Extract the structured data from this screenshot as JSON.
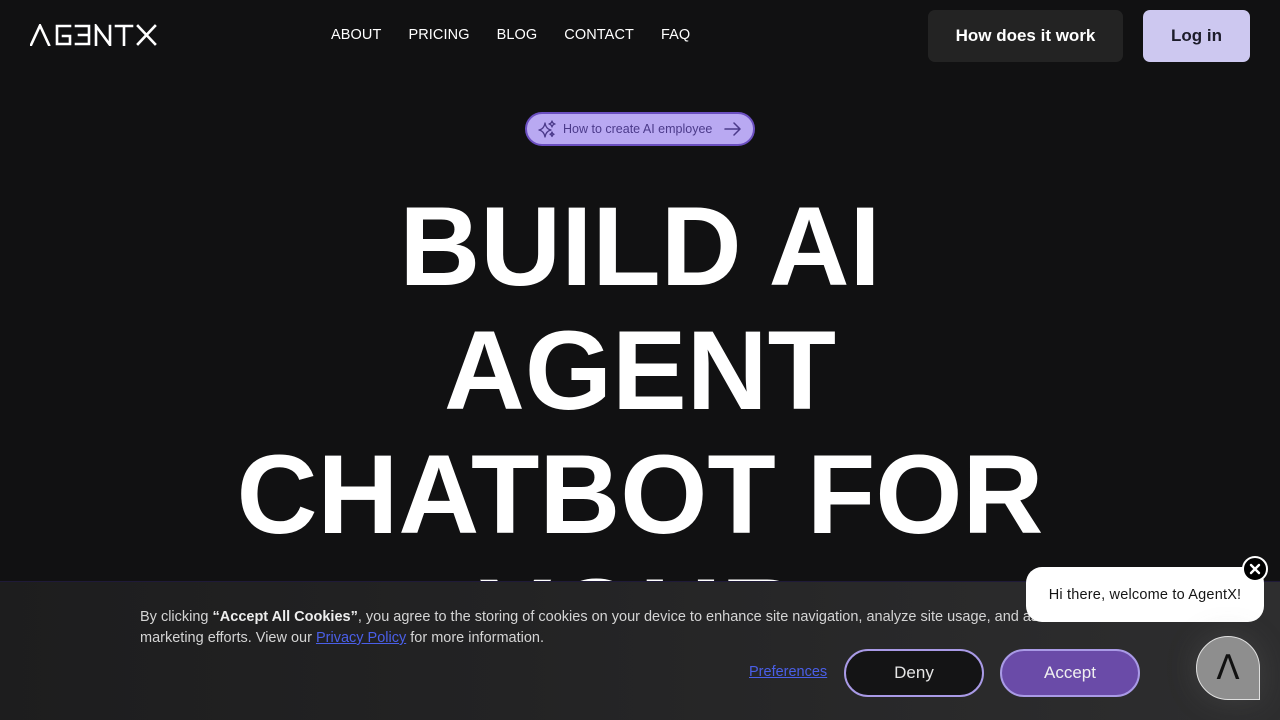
{
  "brand": {
    "logo_text": "AGENTX"
  },
  "nav": {
    "links": [
      "ABOUT",
      "PRICING",
      "BLOG",
      "CONTACT",
      "FAQ"
    ],
    "how_button": "How does it work",
    "login_button": "Log in"
  },
  "hero": {
    "pill_label": "How to create AI employee",
    "pill_icon": "sparkles-icon",
    "pill_arrow": "arrow-right-icon",
    "title_lines": [
      "BUILD AI",
      "AGENT",
      "CHATBOT FOR",
      "YOUR"
    ]
  },
  "cookie_banner": {
    "text_prefix": "By clicking ",
    "text_bold": "“Accept All Cookies”",
    "text_middle": ", you agree to the storing of cookies on your device to enhance site navigation, analyze site usage, and assist in our",
    "text_line2_prefix": "marketing efforts. View our ",
    "privacy_link": "Privacy Policy",
    "text_line2_suffix": " for more information.",
    "preferences_label": "Preferences",
    "deny_label": "Deny",
    "accept_label": "Accept"
  },
  "chat_widget": {
    "greeting": "Hi there, welcome to AgentX!",
    "close_icon": "close-icon",
    "launcher_glyph": "Λ"
  },
  "colors": {
    "background": "#111112",
    "accent_purple": "#6a4ba8",
    "login_bg": "#cdc8f0",
    "link_blue": "#4a5fe8"
  }
}
